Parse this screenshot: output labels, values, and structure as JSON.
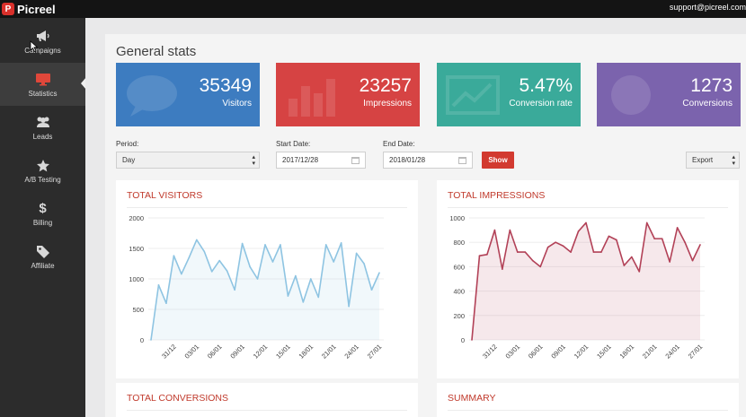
{
  "app": {
    "name": "Picreel",
    "logo_letter": "P",
    "support_email": "support@picreel.com"
  },
  "sidebar": {
    "items": [
      {
        "label": "Campaigns",
        "icon": "megaphone-icon"
      },
      {
        "label": "Statistics",
        "icon": "monitor-icon"
      },
      {
        "label": "Leads",
        "icon": "users-icon"
      },
      {
        "label": "A/B Testing",
        "icon": "star-icon"
      },
      {
        "label": "Billing",
        "icon": "dollar-icon"
      },
      {
        "label": "Affiliate",
        "icon": "tag-icon"
      }
    ],
    "active": "Statistics"
  },
  "page": {
    "title": "General stats"
  },
  "cards": [
    {
      "value": "35349",
      "label": "Visitors",
      "color": "#3d7cc0"
    },
    {
      "value": "23257",
      "label": "Impressions",
      "color": "#d64343"
    },
    {
      "value": "5.47%",
      "label": "Conversion rate",
      "color": "#3aaa9a"
    },
    {
      "value": "1273",
      "label": "Conversions",
      "color": "#7b63ad"
    }
  ],
  "filters": {
    "period_label": "Period:",
    "period_value": "Day",
    "start_label": "Start Date:",
    "start_value": "2017/12/28",
    "end_label": "End Date:",
    "end_value": "2018/01/28",
    "show_button": "Show",
    "export_value": "Export"
  },
  "panels": {
    "visitors_title": "TOTAL VISITORS",
    "impressions_title": "TOTAL IMPRESSIONS",
    "conversions_title": "TOTAL CONVERSIONS",
    "summary_title": "SUMMARY",
    "title_color": "#c0392b"
  },
  "chart_data": [
    {
      "type": "line",
      "title": "TOTAL VISITORS",
      "x_tick_labels": [
        "31/12",
        "03/01",
        "06/01",
        "09/01",
        "12/01",
        "15/01",
        "18/01",
        "21/01",
        "24/01",
        "27/01"
      ],
      "ylim": [
        0,
        2000
      ],
      "y_ticks": [
        0,
        500,
        1000,
        1500,
        2000
      ],
      "series": [
        {
          "color": "#8ec4e2",
          "values": [
            0,
            900,
            600,
            1380,
            1080,
            1350,
            1640,
            1450,
            1120,
            1300,
            1130,
            820,
            1580,
            1200,
            1000,
            1560,
            1280,
            1560,
            720,
            1050,
            620,
            1000,
            700,
            1560,
            1280,
            1590,
            550,
            1420,
            1250,
            820,
            1100
          ]
        }
      ]
    },
    {
      "type": "line",
      "title": "TOTAL IMPRESSIONS",
      "x_tick_labels": [
        "31/12",
        "03/01",
        "06/01",
        "09/01",
        "12/01",
        "15/01",
        "18/01",
        "21/01",
        "24/01",
        "27/01"
      ],
      "ylim": [
        0,
        1000
      ],
      "y_ticks": [
        0,
        200,
        400,
        600,
        800,
        1000
      ],
      "series": [
        {
          "color": "#b24157",
          "values": [
            0,
            690,
            700,
            900,
            580,
            900,
            720,
            720,
            650,
            600,
            760,
            800,
            770,
            720,
            890,
            960,
            720,
            720,
            850,
            820,
            610,
            680,
            560,
            960,
            830,
            830,
            640,
            920,
            800,
            650,
            780
          ]
        }
      ]
    }
  ]
}
